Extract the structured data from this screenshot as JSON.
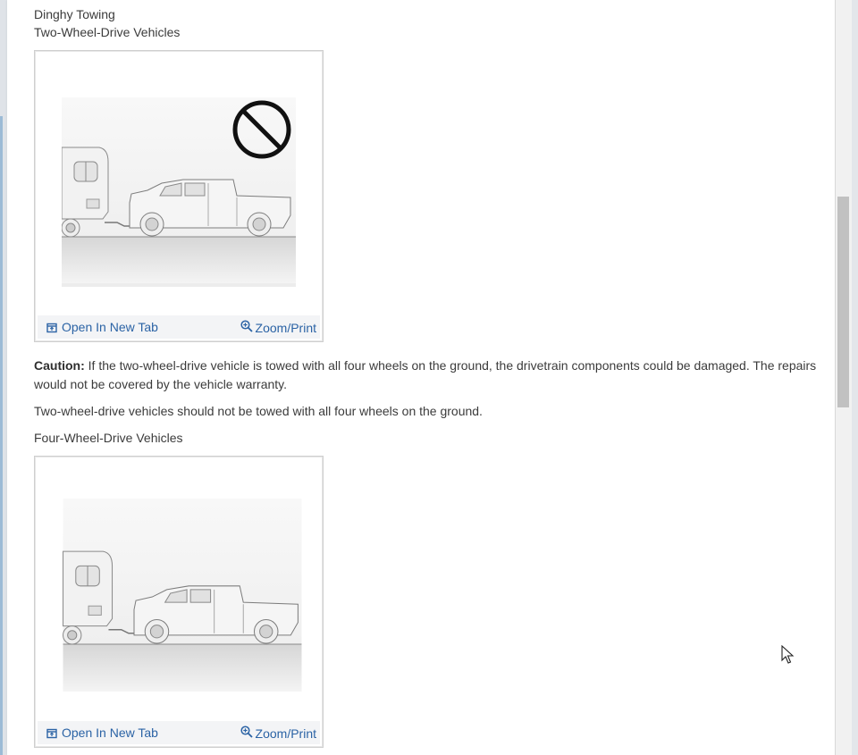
{
  "section": {
    "title": "Dinghy Towing",
    "subtitle_2wd": "Two-Wheel-Drive Vehicles",
    "caution_label": "Caution:",
    "caution_text": " If the two-wheel-drive vehicle is towed with all four wheels on the ground, the drivetrain components could be damaged. The repairs would not be covered by the vehicle warranty.",
    "note_2wd": "Two-wheel-drive vehicles should not be towed with all four wheels on the ground.",
    "subtitle_4wd": "Four-Wheel-Drive Vehicles"
  },
  "figures": [
    {
      "open_tab_label": "Open In New Tab",
      "zoom_label": "Zoom/Print",
      "prohibited": true
    },
    {
      "open_tab_label": "Open In New Tab",
      "zoom_label": "Zoom/Print",
      "prohibited": false
    }
  ],
  "icons": {
    "open_tab": "open-in-new-tab-icon",
    "zoom": "zoom-in-icon",
    "prohibited": "prohibited-icon",
    "cursor": "mouse-pointer-icon"
  },
  "colors": {
    "link": "#2b63a5",
    "text": "#3b3b3b"
  }
}
